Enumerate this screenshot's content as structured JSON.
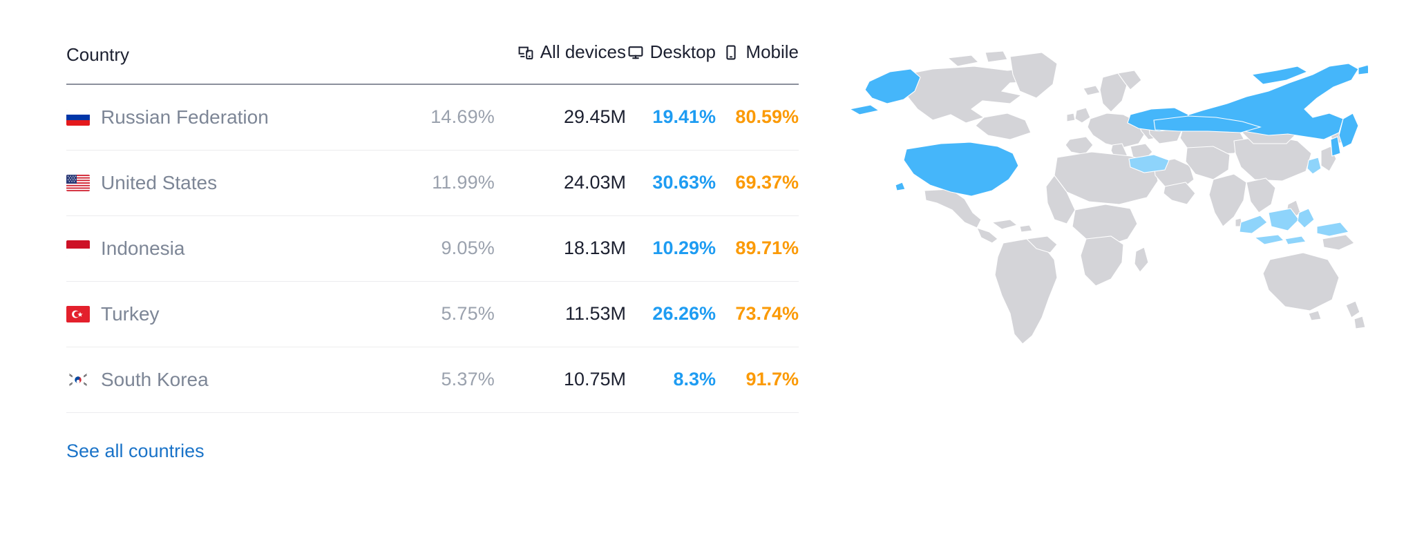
{
  "table": {
    "columns": [
      {
        "key": "country",
        "label": "Country",
        "icon": null
      },
      {
        "key": "share",
        "label": "",
        "icon": null
      },
      {
        "key": "alldev",
        "label": "All devices",
        "icon": "all-devices-icon"
      },
      {
        "key": "desktop",
        "label": "Desktop",
        "icon": "desktop-icon"
      },
      {
        "key": "mobile",
        "label": "Mobile",
        "icon": "mobile-icon"
      }
    ],
    "rows": [
      {
        "flag": "flag-russia",
        "country": "Russian Federation",
        "share": "14.69%",
        "all_devices": "29.45M",
        "desktop": "19.41%",
        "mobile": "80.59%"
      },
      {
        "flag": "flag-united-states",
        "country": "United States",
        "share": "11.99%",
        "all_devices": "24.03M",
        "desktop": "30.63%",
        "mobile": "69.37%"
      },
      {
        "flag": "flag-indonesia",
        "country": "Indonesia",
        "share": "9.05%",
        "all_devices": "18.13M",
        "desktop": "10.29%",
        "mobile": "89.71%"
      },
      {
        "flag": "flag-turkey",
        "country": "Turkey",
        "share": "5.75%",
        "all_devices": "11.53M",
        "desktop": "26.26%",
        "mobile": "73.74%"
      },
      {
        "flag": "flag-south-korea",
        "country": "South Korea",
        "share": "5.37%",
        "all_devices": "10.75M",
        "desktop": "8.3%",
        "mobile": "91.7%"
      }
    ]
  },
  "footer": {
    "see_all_label": "See all countries"
  },
  "map": {
    "highlighted_strong": [
      "Russian Federation",
      "United States"
    ],
    "highlighted_light": [
      "Turkey",
      "Indonesia",
      "South Korea"
    ]
  },
  "colors": {
    "desktop": "#1e9cf2",
    "mobile": "#fb9a06",
    "link": "#1a73c8",
    "map_highlight": "#45b6fa",
    "map_highlight_light": "#8ed4fb",
    "map_land": "#d4d4d8",
    "country_name": "#7d8696",
    "share": "#9aa1ad",
    "all_devices": "#1c2030"
  }
}
